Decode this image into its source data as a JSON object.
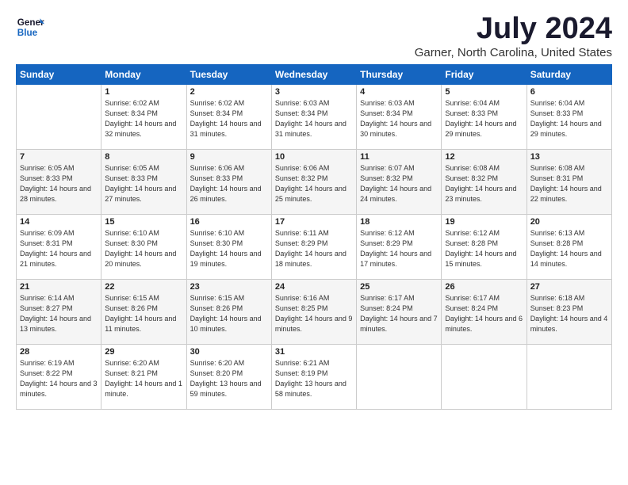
{
  "logo": {
    "line1": "General",
    "line2": "Blue"
  },
  "title": "July 2024",
  "subtitle": "Garner, North Carolina, United States",
  "headers": [
    "Sunday",
    "Monday",
    "Tuesday",
    "Wednesday",
    "Thursday",
    "Friday",
    "Saturday"
  ],
  "weeks": [
    [
      {
        "day": "",
        "sunrise": "",
        "sunset": "",
        "daylight": ""
      },
      {
        "day": "1",
        "sunrise": "Sunrise: 6:02 AM",
        "sunset": "Sunset: 8:34 PM",
        "daylight": "Daylight: 14 hours and 32 minutes."
      },
      {
        "day": "2",
        "sunrise": "Sunrise: 6:02 AM",
        "sunset": "Sunset: 8:34 PM",
        "daylight": "Daylight: 14 hours and 31 minutes."
      },
      {
        "day": "3",
        "sunrise": "Sunrise: 6:03 AM",
        "sunset": "Sunset: 8:34 PM",
        "daylight": "Daylight: 14 hours and 31 minutes."
      },
      {
        "day": "4",
        "sunrise": "Sunrise: 6:03 AM",
        "sunset": "Sunset: 8:34 PM",
        "daylight": "Daylight: 14 hours and 30 minutes."
      },
      {
        "day": "5",
        "sunrise": "Sunrise: 6:04 AM",
        "sunset": "Sunset: 8:33 PM",
        "daylight": "Daylight: 14 hours and 29 minutes."
      },
      {
        "day": "6",
        "sunrise": "Sunrise: 6:04 AM",
        "sunset": "Sunset: 8:33 PM",
        "daylight": "Daylight: 14 hours and 29 minutes."
      }
    ],
    [
      {
        "day": "7",
        "sunrise": "Sunrise: 6:05 AM",
        "sunset": "Sunset: 8:33 PM",
        "daylight": "Daylight: 14 hours and 28 minutes."
      },
      {
        "day": "8",
        "sunrise": "Sunrise: 6:05 AM",
        "sunset": "Sunset: 8:33 PM",
        "daylight": "Daylight: 14 hours and 27 minutes."
      },
      {
        "day": "9",
        "sunrise": "Sunrise: 6:06 AM",
        "sunset": "Sunset: 8:33 PM",
        "daylight": "Daylight: 14 hours and 26 minutes."
      },
      {
        "day": "10",
        "sunrise": "Sunrise: 6:06 AM",
        "sunset": "Sunset: 8:32 PM",
        "daylight": "Daylight: 14 hours and 25 minutes."
      },
      {
        "day": "11",
        "sunrise": "Sunrise: 6:07 AM",
        "sunset": "Sunset: 8:32 PM",
        "daylight": "Daylight: 14 hours and 24 minutes."
      },
      {
        "day": "12",
        "sunrise": "Sunrise: 6:08 AM",
        "sunset": "Sunset: 8:32 PM",
        "daylight": "Daylight: 14 hours and 23 minutes."
      },
      {
        "day": "13",
        "sunrise": "Sunrise: 6:08 AM",
        "sunset": "Sunset: 8:31 PM",
        "daylight": "Daylight: 14 hours and 22 minutes."
      }
    ],
    [
      {
        "day": "14",
        "sunrise": "Sunrise: 6:09 AM",
        "sunset": "Sunset: 8:31 PM",
        "daylight": "Daylight: 14 hours and 21 minutes."
      },
      {
        "day": "15",
        "sunrise": "Sunrise: 6:10 AM",
        "sunset": "Sunset: 8:30 PM",
        "daylight": "Daylight: 14 hours and 20 minutes."
      },
      {
        "day": "16",
        "sunrise": "Sunrise: 6:10 AM",
        "sunset": "Sunset: 8:30 PM",
        "daylight": "Daylight: 14 hours and 19 minutes."
      },
      {
        "day": "17",
        "sunrise": "Sunrise: 6:11 AM",
        "sunset": "Sunset: 8:29 PM",
        "daylight": "Daylight: 14 hours and 18 minutes."
      },
      {
        "day": "18",
        "sunrise": "Sunrise: 6:12 AM",
        "sunset": "Sunset: 8:29 PM",
        "daylight": "Daylight: 14 hours and 17 minutes."
      },
      {
        "day": "19",
        "sunrise": "Sunrise: 6:12 AM",
        "sunset": "Sunset: 8:28 PM",
        "daylight": "Daylight: 14 hours and 15 minutes."
      },
      {
        "day": "20",
        "sunrise": "Sunrise: 6:13 AM",
        "sunset": "Sunset: 8:28 PM",
        "daylight": "Daylight: 14 hours and 14 minutes."
      }
    ],
    [
      {
        "day": "21",
        "sunrise": "Sunrise: 6:14 AM",
        "sunset": "Sunset: 8:27 PM",
        "daylight": "Daylight: 14 hours and 13 minutes."
      },
      {
        "day": "22",
        "sunrise": "Sunrise: 6:15 AM",
        "sunset": "Sunset: 8:26 PM",
        "daylight": "Daylight: 14 hours and 11 minutes."
      },
      {
        "day": "23",
        "sunrise": "Sunrise: 6:15 AM",
        "sunset": "Sunset: 8:26 PM",
        "daylight": "Daylight: 14 hours and 10 minutes."
      },
      {
        "day": "24",
        "sunrise": "Sunrise: 6:16 AM",
        "sunset": "Sunset: 8:25 PM",
        "daylight": "Daylight: 14 hours and 9 minutes."
      },
      {
        "day": "25",
        "sunrise": "Sunrise: 6:17 AM",
        "sunset": "Sunset: 8:24 PM",
        "daylight": "Daylight: 14 hours and 7 minutes."
      },
      {
        "day": "26",
        "sunrise": "Sunrise: 6:17 AM",
        "sunset": "Sunset: 8:24 PM",
        "daylight": "Daylight: 14 hours and 6 minutes."
      },
      {
        "day": "27",
        "sunrise": "Sunrise: 6:18 AM",
        "sunset": "Sunset: 8:23 PM",
        "daylight": "Daylight: 14 hours and 4 minutes."
      }
    ],
    [
      {
        "day": "28",
        "sunrise": "Sunrise: 6:19 AM",
        "sunset": "Sunset: 8:22 PM",
        "daylight": "Daylight: 14 hours and 3 minutes."
      },
      {
        "day": "29",
        "sunrise": "Sunrise: 6:20 AM",
        "sunset": "Sunset: 8:21 PM",
        "daylight": "Daylight: 14 hours and 1 minute."
      },
      {
        "day": "30",
        "sunrise": "Sunrise: 6:20 AM",
        "sunset": "Sunset: 8:20 PM",
        "daylight": "Daylight: 13 hours and 59 minutes."
      },
      {
        "day": "31",
        "sunrise": "Sunrise: 6:21 AM",
        "sunset": "Sunset: 8:19 PM",
        "daylight": "Daylight: 13 hours and 58 minutes."
      },
      {
        "day": "",
        "sunrise": "",
        "sunset": "",
        "daylight": ""
      },
      {
        "day": "",
        "sunrise": "",
        "sunset": "",
        "daylight": ""
      },
      {
        "day": "",
        "sunrise": "",
        "sunset": "",
        "daylight": ""
      }
    ]
  ]
}
